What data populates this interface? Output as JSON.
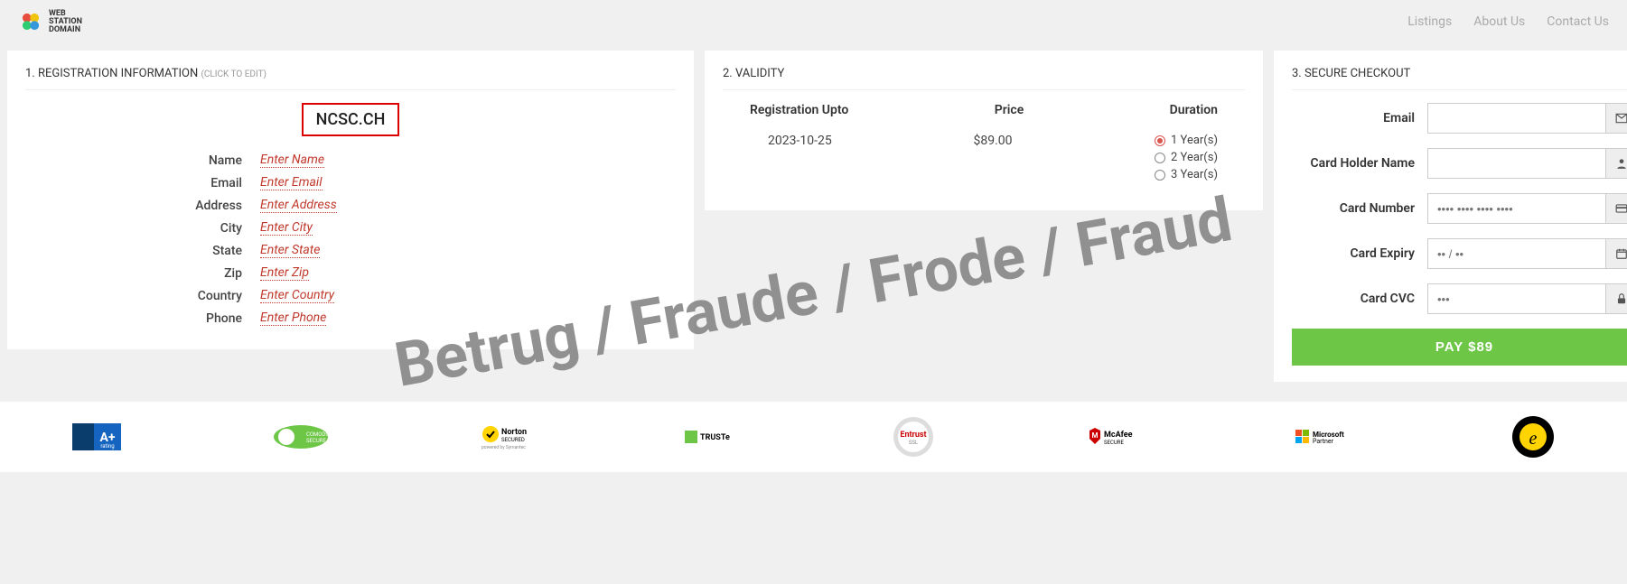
{
  "logo_text_line1": "WEB",
  "logo_text_line2": "STATION",
  "logo_text_line3": "DOMAIN",
  "nav": {
    "listings": "Listings",
    "about": "About Us",
    "contact": "Contact Us"
  },
  "panel1": {
    "title": "1. REGISTRATION INFORMATION",
    "subtitle": "(CLICK TO EDIT)",
    "domain": "NCSC.CH",
    "fields": {
      "name_label": "Name",
      "name_val": "Enter Name",
      "email_label": "Email",
      "email_val": "Enter Email",
      "address_label": "Address",
      "address_val": "Enter Address",
      "city_label": "City",
      "city_val": "Enter City",
      "state_label": "State",
      "state_val": "Enter State",
      "zip_label": "Zip",
      "zip_val": "Enter Zip",
      "country_label": "Country",
      "country_val": "Enter Country",
      "phone_label": "Phone",
      "phone_val": "Enter Phone"
    }
  },
  "panel2": {
    "title": "2. VALIDITY",
    "head_reg": "Registration Upto",
    "head_price": "Price",
    "head_duration": "Duration",
    "reg_date": "2023-10-25",
    "price": "$89.00",
    "opt1": "1 Year(s)",
    "opt2": "2 Year(s)",
    "opt3": "3 Year(s)"
  },
  "panel3": {
    "title": "3. SECURE CHECKOUT",
    "email_label": "Email",
    "holder_label": "Card Holder Name",
    "number_label": "Card Number",
    "number_placeholder": "•••• •••• •••• ••••",
    "expiry_label": "Card Expiry",
    "expiry_placeholder": "•• / ••",
    "cvc_label": "Card CVC",
    "cvc_placeholder": "•••",
    "pay_button": "PAY $89"
  },
  "trust": {
    "bbb": "A+ rating",
    "comodo": "COMODO SECURE",
    "norton": "Norton SECURED",
    "truste": "TRUSTe",
    "entrust": "Entrust SSL",
    "mcafee": "McAfee SECURE",
    "microsoft": "Microsoft Partner",
    "trustedshops": "TRUSTED SHOPS GUARANTEE"
  },
  "watermark": "Betrug / Fraude / Frode / Fraud"
}
